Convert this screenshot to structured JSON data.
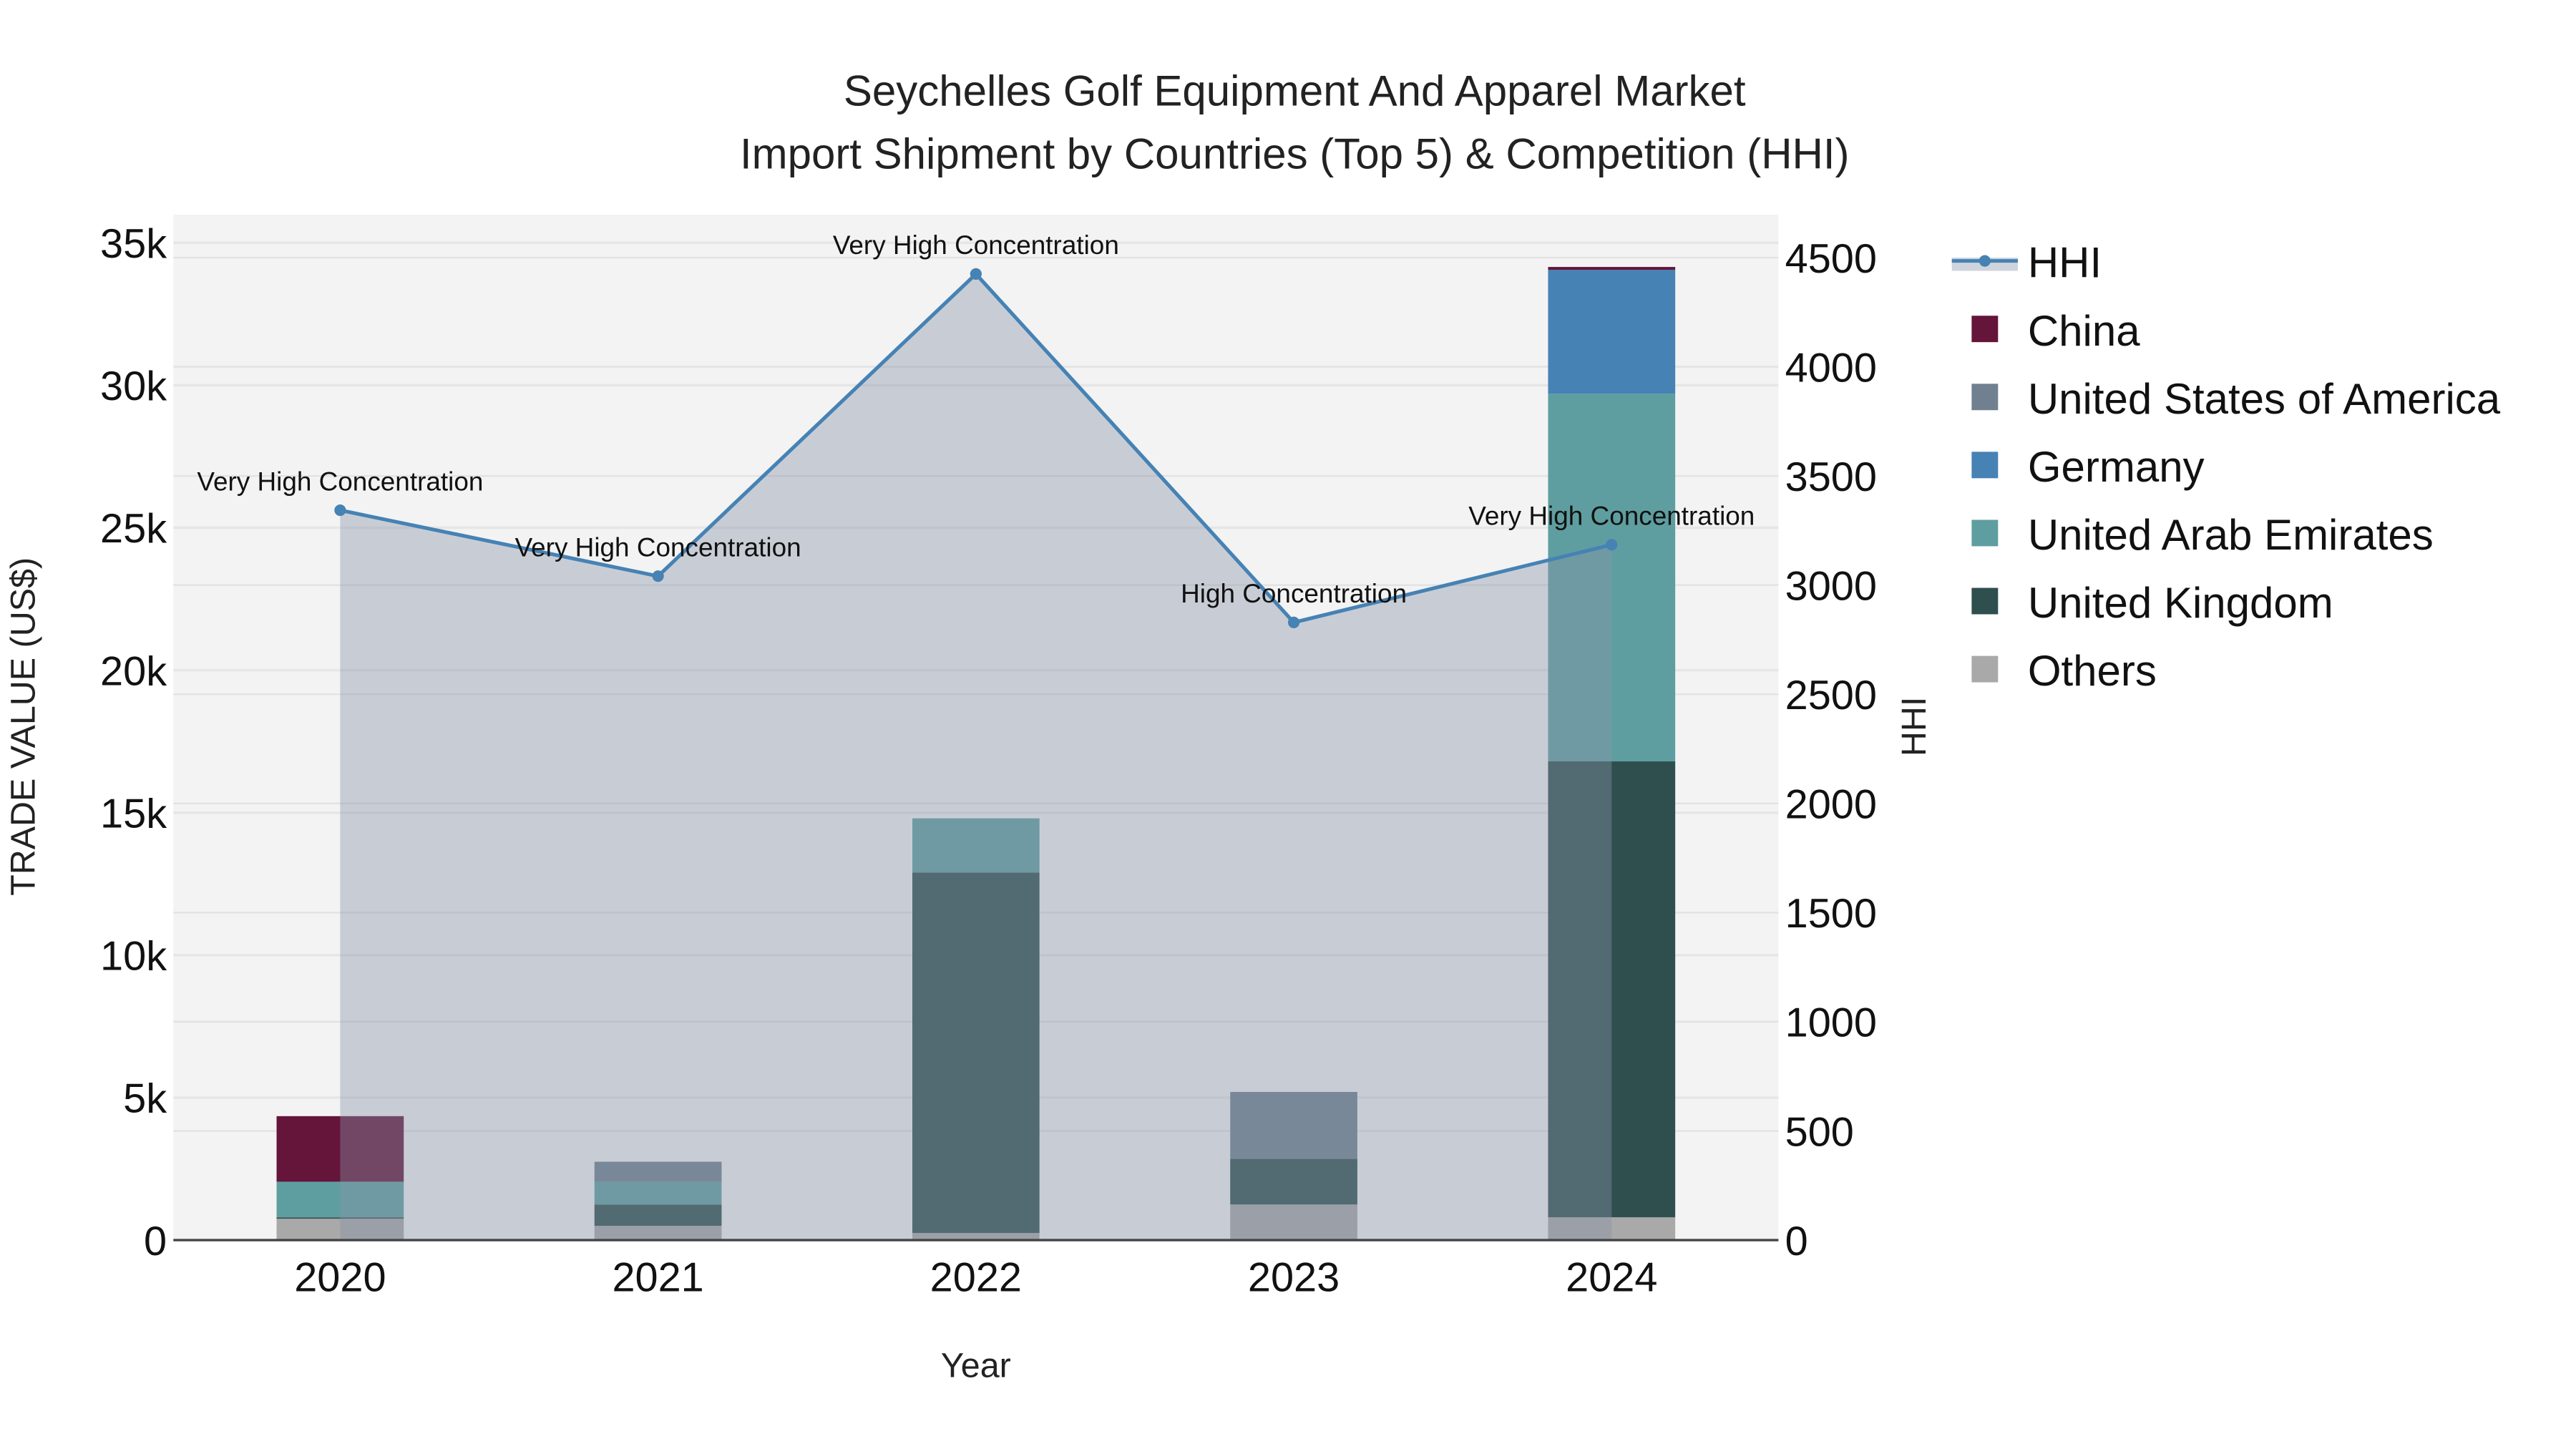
{
  "chart_data": {
    "type": "bar",
    "title": "Seychelles Golf Equipment And Apparel Market",
    "subtitle": "Import Shipment by Countries (Top 5) & Competition (HHI)",
    "xlabel": "Year",
    "ylabel": "TRADE VALUE (US$)",
    "y2label": "HHI",
    "stacked": true,
    "categories": [
      "2020",
      "2021",
      "2022",
      "2023",
      "2024"
    ],
    "ylim": [
      0,
      36000
    ],
    "y2lim": [
      0,
      4680
    ],
    "yticks": [
      0,
      5000,
      10000,
      15000,
      20000,
      25000,
      30000,
      35000
    ],
    "ytick_labels": [
      "0",
      "5k",
      "10k",
      "15k",
      "20k",
      "25k",
      "30k",
      "35k"
    ],
    "y2ticks": [
      0,
      500,
      1000,
      1500,
      2000,
      2500,
      3000,
      3500,
      4000,
      4500
    ],
    "y2tick_labels": [
      "0",
      "500",
      "1000",
      "1500",
      "2000",
      "2500",
      "3000",
      "3500",
      "4000",
      "4500"
    ],
    "series": [
      {
        "name": "Others",
        "color": "#a9a9a9",
        "values": [
          750,
          500,
          250,
          1250,
          800
        ]
      },
      {
        "name": "United Kingdom",
        "color": "#2f4f4f",
        "values": [
          50,
          750,
          12650,
          1600,
          16000
        ]
      },
      {
        "name": "United Arab Emirates",
        "color": "#5f9ea0",
        "values": [
          1250,
          800,
          1900,
          0,
          12900
        ]
      },
      {
        "name": "Germany",
        "color": "#4682b4",
        "values": [
          0,
          0,
          0,
          0,
          4350
        ]
      },
      {
        "name": "United States of America",
        "color": "#708090",
        "values": [
          0,
          700,
          0,
          2350,
          0
        ]
      },
      {
        "name": "China",
        "color": "#641539",
        "values": [
          2300,
          0,
          0,
          0,
          100
        ]
      }
    ],
    "legend_order": [
      "HHI",
      "China",
      "United States of America",
      "Germany",
      "United Arab Emirates",
      "United Kingdom",
      "Others"
    ],
    "legend_position": "right",
    "line": {
      "name": "HHI",
      "color": "#4682b4",
      "axis": "right",
      "values": [
        3343,
        3041,
        4425,
        2829,
        3185
      ],
      "annotations": [
        "Very High Concentration",
        "Very High Concentration",
        "Very High Concentration",
        "High Concentration",
        "Very High Concentration"
      ]
    },
    "grid": true
  }
}
